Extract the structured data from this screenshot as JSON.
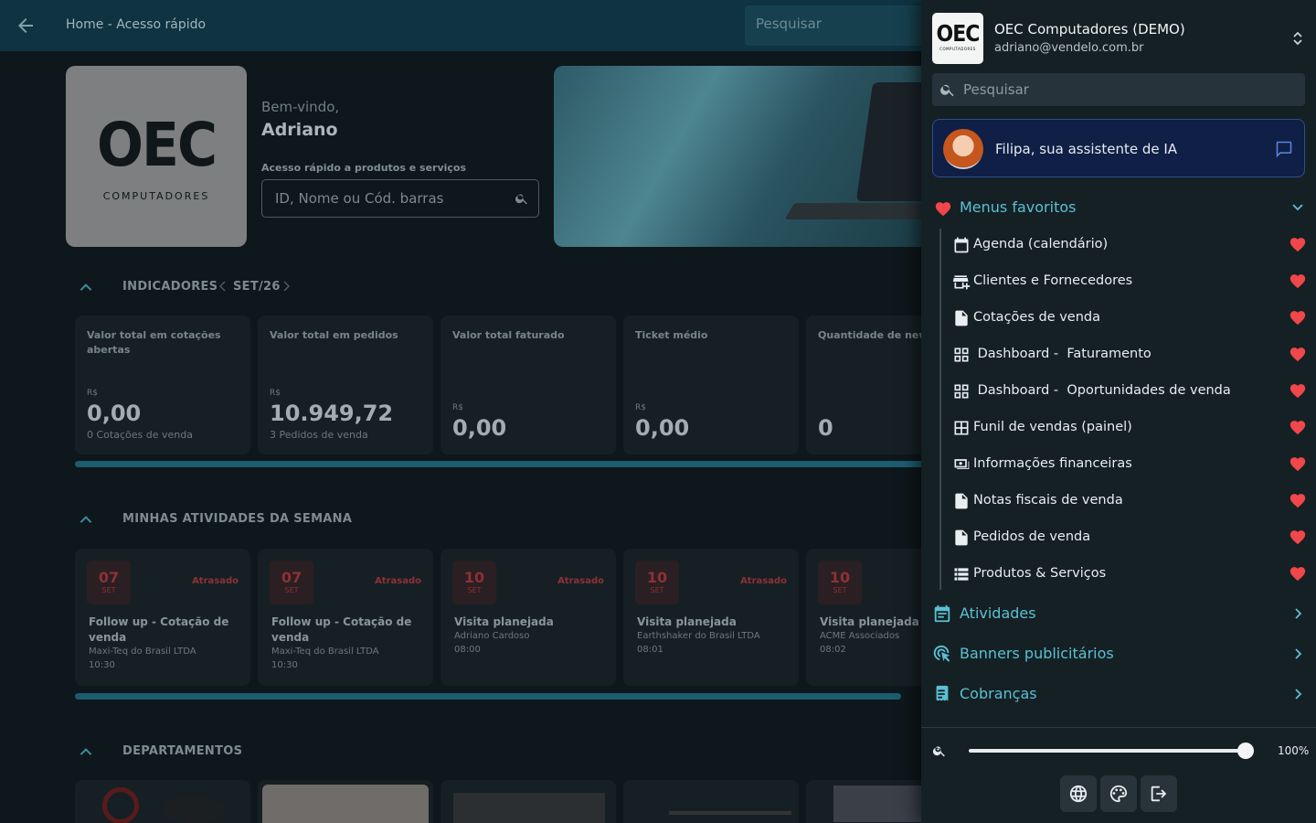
{
  "header": {
    "breadcrumb": "Home - Acesso rápido",
    "search_placeholder": "Pesquisar"
  },
  "company_logo": {
    "mark": "OEC",
    "subtitle": "COMPUTADORES"
  },
  "welcome": {
    "greeting": "Bem-vindo,",
    "user": "Adriano",
    "quick_access_label": "Acesso rápido a produtos e serviços",
    "quick_access_placeholder": "ID, Nome ou Cód. barras"
  },
  "indicators": {
    "title": "INDICADORES",
    "period": "SET/26",
    "cards": [
      {
        "title": "Valor total em cotações abertas",
        "currency": "R$",
        "value": "0,00",
        "sub": "0 Cotações de venda"
      },
      {
        "title": "Valor total em pedidos",
        "currency": "R$",
        "value": "10.949,72",
        "sub": "3 Pedidos de venda"
      },
      {
        "title": "Valor total faturado",
        "currency": "R$",
        "value": "0,00",
        "sub": ""
      },
      {
        "title": "Ticket médio",
        "currency": "R$",
        "value": "0,00",
        "sub": ""
      },
      {
        "title": "Quantidade de new c",
        "currency": "",
        "value": "0",
        "sub": ""
      }
    ]
  },
  "activities": {
    "title": "MINHAS ATIVIDADES DA SEMANA",
    "cards": [
      {
        "day": "07",
        "month": "SET",
        "status": "Atrasado",
        "title": "Follow up - Cotação de venda",
        "company": "Maxi-Teq do Brasil LTDA",
        "time": "10:30"
      },
      {
        "day": "07",
        "month": "SET",
        "status": "Atrasado",
        "title": "Follow up - Cotação de venda",
        "company": "Maxi-Teq do Brasil LTDA",
        "time": "10:30"
      },
      {
        "day": "10",
        "month": "SET",
        "status": "Atrasado",
        "title": "Visita planejada",
        "company": "Adriano Cardoso",
        "time": "08:00"
      },
      {
        "day": "10",
        "month": "SET",
        "status": "Atrasado",
        "title": "Visita planejada",
        "company": "Earthshaker do Brasil LTDA",
        "time": "08:01"
      },
      {
        "day": "10",
        "month": "SET",
        "status": "",
        "title": "Visita planejada",
        "company": "ACME Associados",
        "time": "08:02"
      }
    ]
  },
  "departments": {
    "title": "DEPARTAMENTOS"
  },
  "drawer": {
    "account": {
      "logo_mark": "OEC",
      "logo_sub": "COMPUTADORES",
      "name": "OEC Computadores (DEMO)",
      "email": "adriano@vendelo.com.br"
    },
    "search_placeholder": "Pesquisar",
    "assistant": "Filipa, sua assistente de IA",
    "favorites": {
      "title": "Menus favoritos",
      "items": [
        {
          "label": "Agenda (calendário)",
          "icon": "calendar-icon"
        },
        {
          "label": "Clientes e Fornecedores",
          "icon": "store-add-icon"
        },
        {
          "label": "Cotações de venda",
          "icon": "document-icon"
        },
        {
          "label": " Dashboard -  Faturamento",
          "icon": "dashboard-icon"
        },
        {
          "label": " Dashboard -  Oportunidades de venda",
          "icon": "dashboard-icon"
        },
        {
          "label": "Funil de vendas (painel)",
          "icon": "grid-icon"
        },
        {
          "label": "Informações financeiras",
          "icon": "money-icon"
        },
        {
          "label": "Notas fiscais de venda",
          "icon": "document-icon"
        },
        {
          "label": "Pedidos de venda",
          "icon": "document-icon"
        },
        {
          "label": "Produtos & Serviços",
          "icon": "list-icon"
        }
      ]
    },
    "menus": [
      {
        "label": "Atividades",
        "icon": "calendar-list-icon"
      },
      {
        "label": "Banners publicitários",
        "icon": "cursor-click-icon"
      },
      {
        "label": "Cobranças",
        "icon": "receipt-icon"
      }
    ],
    "zoom": "100%",
    "zoom_fraction": 0.97
  },
  "colors": {
    "accent": "#5ac0d2",
    "heart": "#f0474a",
    "drawer_bg": "#152024",
    "ai_border": "#304c92"
  }
}
